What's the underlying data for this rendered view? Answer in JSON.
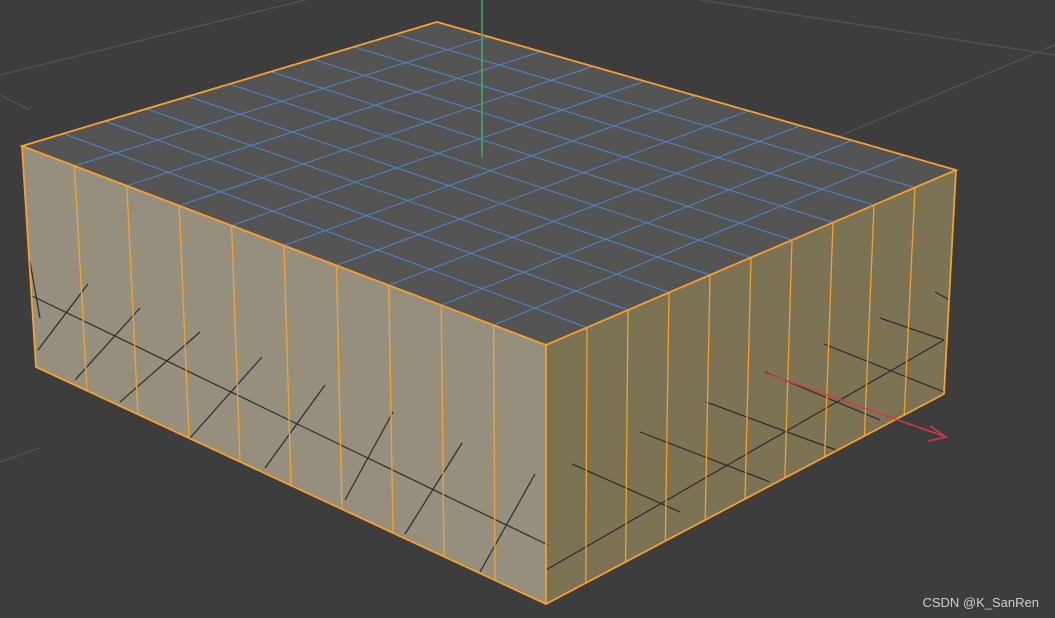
{
  "watermark": {
    "text": "CSDN @K_SanRen"
  },
  "viewport": {
    "object": "box",
    "selection_color": "#f5a030",
    "background_color": "#3d3d3d",
    "top_face_color": "#545454",
    "front_face_color": "#9b9380",
    "side_face_color": "#7e7655",
    "top_grid_color": "#4f86c7",
    "floor_grid_color": "#2c2c2c",
    "x_axis_color": "#cc3b46",
    "y_axis_color": "#3fae68"
  }
}
